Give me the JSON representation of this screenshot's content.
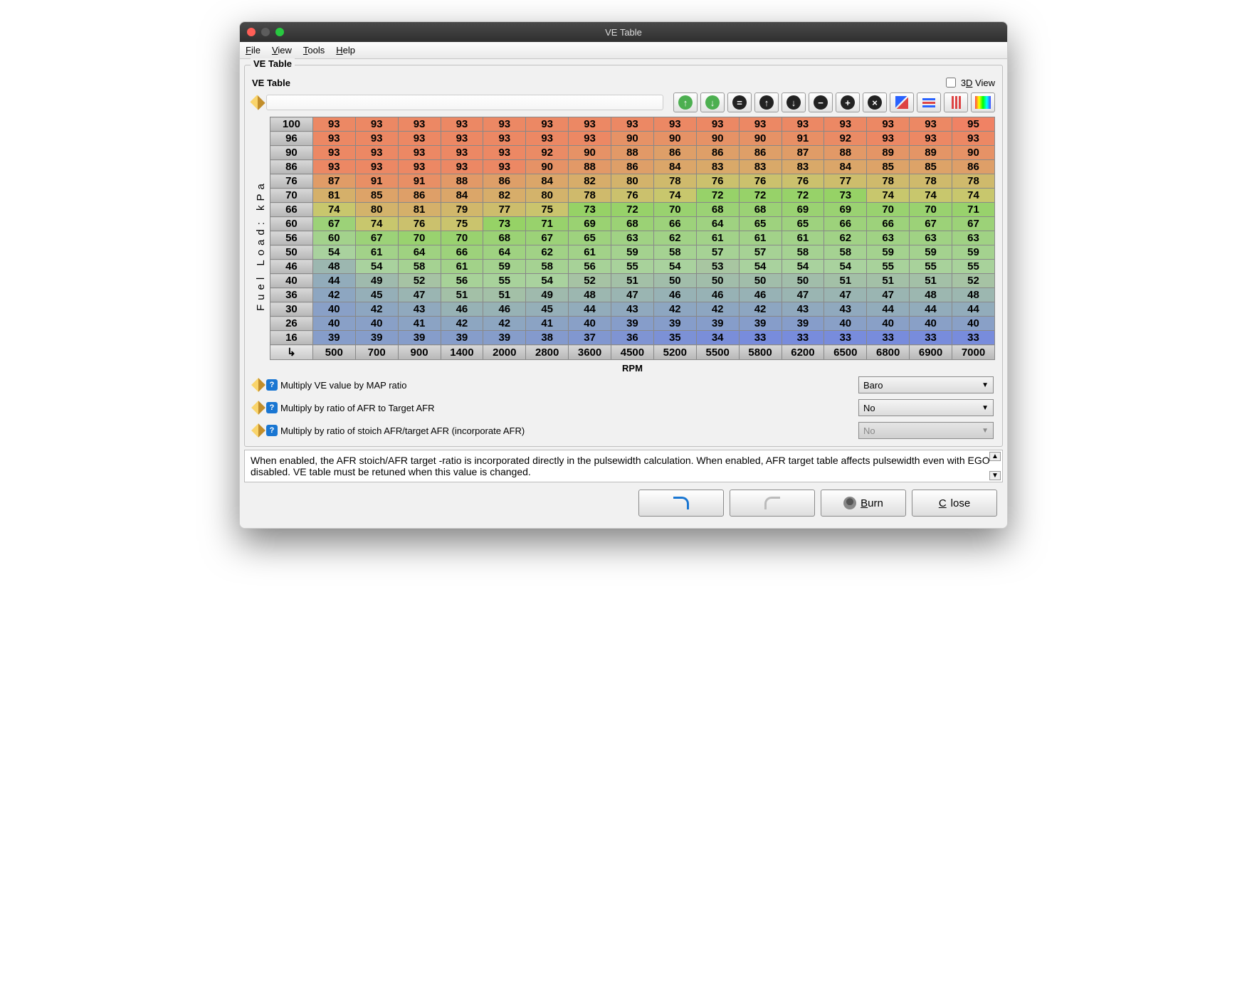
{
  "window": {
    "title": "VE Table"
  },
  "menu": {
    "file": "File",
    "view": "View",
    "tools": "Tools",
    "help": "Help"
  },
  "panel": {
    "legend": "VE Table",
    "subtitle": "VE Table",
    "view3d": "3D View"
  },
  "axes": {
    "y": "Fuel Load: kPa",
    "x": "RPM"
  },
  "chart_data": {
    "type": "table",
    "row_headers": [
      100,
      96,
      90,
      86,
      76,
      70,
      66,
      60,
      56,
      50,
      46,
      40,
      36,
      30,
      26,
      16
    ],
    "col_headers": [
      500,
      700,
      900,
      1400,
      2000,
      2800,
      3600,
      4500,
      5200,
      5500,
      5800,
      6200,
      6500,
      6800,
      6900,
      7000
    ],
    "values": [
      [
        93,
        93,
        93,
        93,
        93,
        93,
        93,
        93,
        93,
        93,
        93,
        93,
        93,
        93,
        93,
        95
      ],
      [
        93,
        93,
        93,
        93,
        93,
        93,
        93,
        90,
        90,
        90,
        90,
        91,
        92,
        93,
        93,
        93
      ],
      [
        93,
        93,
        93,
        93,
        93,
        92,
        90,
        88,
        86,
        86,
        86,
        87,
        88,
        89,
        89,
        90
      ],
      [
        93,
        93,
        93,
        93,
        93,
        90,
        88,
        86,
        84,
        83,
        83,
        83,
        84,
        85,
        85,
        86
      ],
      [
        87,
        91,
        91,
        88,
        86,
        84,
        82,
        80,
        78,
        76,
        76,
        76,
        77,
        78,
        78,
        78
      ],
      [
        81,
        85,
        86,
        84,
        82,
        80,
        78,
        76,
        74,
        72,
        72,
        72,
        73,
        74,
        74,
        74
      ],
      [
        74,
        80,
        81,
        79,
        77,
        75,
        73,
        72,
        70,
        68,
        68,
        69,
        69,
        70,
        70,
        71
      ],
      [
        67,
        74,
        76,
        75,
        73,
        71,
        69,
        68,
        66,
        64,
        65,
        65,
        66,
        66,
        67,
        67
      ],
      [
        60,
        67,
        70,
        70,
        68,
        67,
        65,
        63,
        62,
        61,
        61,
        61,
        62,
        63,
        63,
        63
      ],
      [
        54,
        61,
        64,
        66,
        64,
        62,
        61,
        59,
        58,
        57,
        57,
        58,
        58,
        59,
        59,
        59
      ],
      [
        48,
        54,
        58,
        61,
        59,
        58,
        56,
        55,
        54,
        53,
        54,
        54,
        54,
        55,
        55,
        55
      ],
      [
        44,
        49,
        52,
        56,
        55,
        54,
        52,
        51,
        50,
        50,
        50,
        50,
        51,
        51,
        51,
        52
      ],
      [
        42,
        45,
        47,
        51,
        51,
        49,
        48,
        47,
        46,
        46,
        46,
        47,
        47,
        47,
        48,
        48
      ],
      [
        40,
        42,
        43,
        46,
        46,
        45,
        44,
        43,
        42,
        42,
        42,
        43,
        43,
        44,
        44,
        44
      ],
      [
        40,
        40,
        41,
        42,
        42,
        41,
        40,
        39,
        39,
        39,
        39,
        39,
        40,
        40,
        40,
        40
      ],
      [
        39,
        39,
        39,
        39,
        39,
        38,
        37,
        36,
        35,
        34,
        33,
        33,
        33,
        33,
        33,
        33
      ]
    ]
  },
  "options": {
    "opt1": {
      "label": "Multiply VE value by MAP ratio",
      "value": "Baro"
    },
    "opt2": {
      "label": "Multiply by ratio of AFR to Target AFR",
      "value": "No"
    },
    "opt3": {
      "label": "Multiply by ratio of stoich AFR/target AFR (incorporate AFR)",
      "value": "No"
    }
  },
  "description": "When enabled, the AFR stoich/AFR target -ratio is incorporated directly in the pulsewidth calculation. When enabled, AFR target table affects pulsewidth even with EGO disabled. VE table must be retuned when this value is changed.",
  "footer": {
    "burn": "Burn",
    "close": "Close"
  }
}
